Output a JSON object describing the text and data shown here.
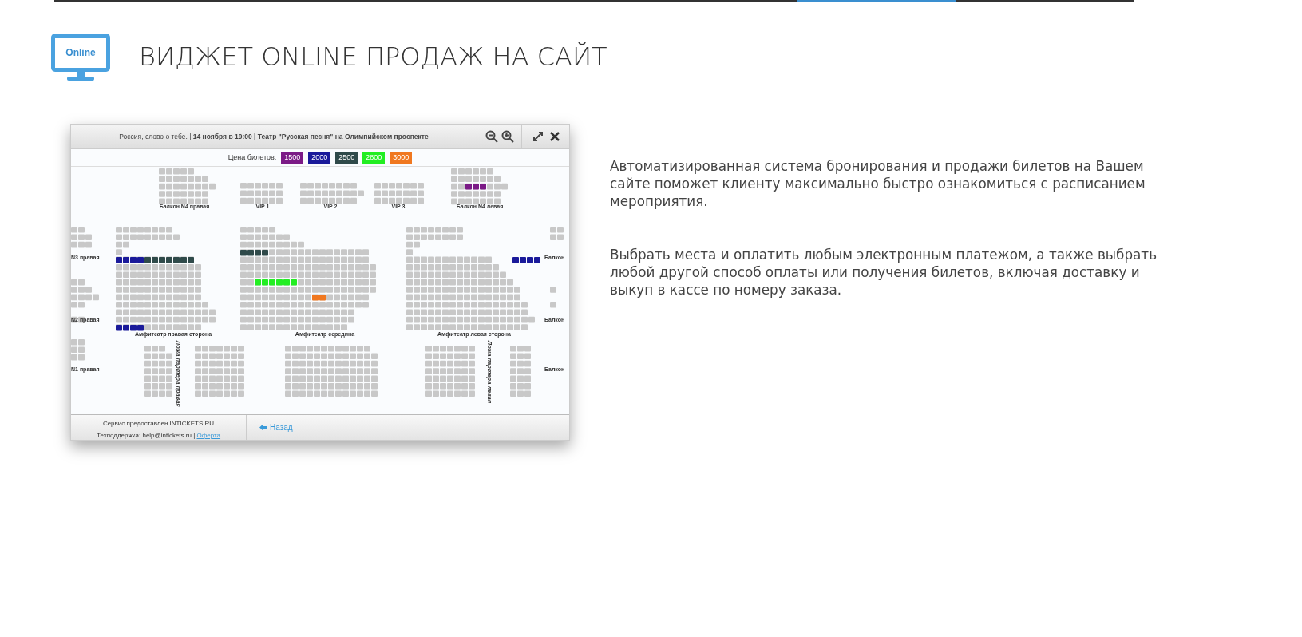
{
  "header": {
    "icon_text": "Online",
    "title": "ВИДЖЕТ ONLINE ПРОДАЖ НА САЙТ"
  },
  "widget": {
    "title": "Россия, слово о тебе. | **14 ноября в 19:00 | Театр \"Русская песня\" на Олимпийском проспекте**",
    "price_label": "Цена билетов:",
    "prices": [
      {
        "label": "1500",
        "color": "#7b1a86"
      },
      {
        "label": "2000",
        "color": "#1a1a9a"
      },
      {
        "label": "2500",
        "color": "#2f4a4a"
      },
      {
        "label": "2800",
        "color": "#22ee22"
      },
      {
        "label": "3000",
        "color": "#f07820"
      }
    ],
    "section_labels": [
      "Балкон N4 правая",
      "VIP 1",
      "VIP 2",
      "VIP 3",
      "Балкон N4 левая",
      "N3 правая",
      "N2 правая",
      "Амфитеатр правая сторона",
      "Амфитеатр середина",
      "Амфитеатр левая сторона",
      "Балкон",
      "Балкон",
      "N1 правая",
      "Балкон",
      "Ложа партера правая",
      "Ложа партера левая"
    ],
    "footer_service": "Сервис предоставлен INTICKETS.RU",
    "footer_support": "Техподдержка: help@intickets.ru",
    "footer_separator": "|",
    "footer_link": "Оферта",
    "back_button": "Назад"
  },
  "paragraphs": [
    "Автоматизированная система бронирования и продажи билетов на Вашем сайте поможет клиенту максимально быстро ознакомиться с расписанием мероприятия.",
    "Выбрать места и оплатить любым электронным платежом, а также выбрать любой другой способ оплаты или получения билетов, включая доставку и выкуп в кассе по номеру заказа."
  ]
}
